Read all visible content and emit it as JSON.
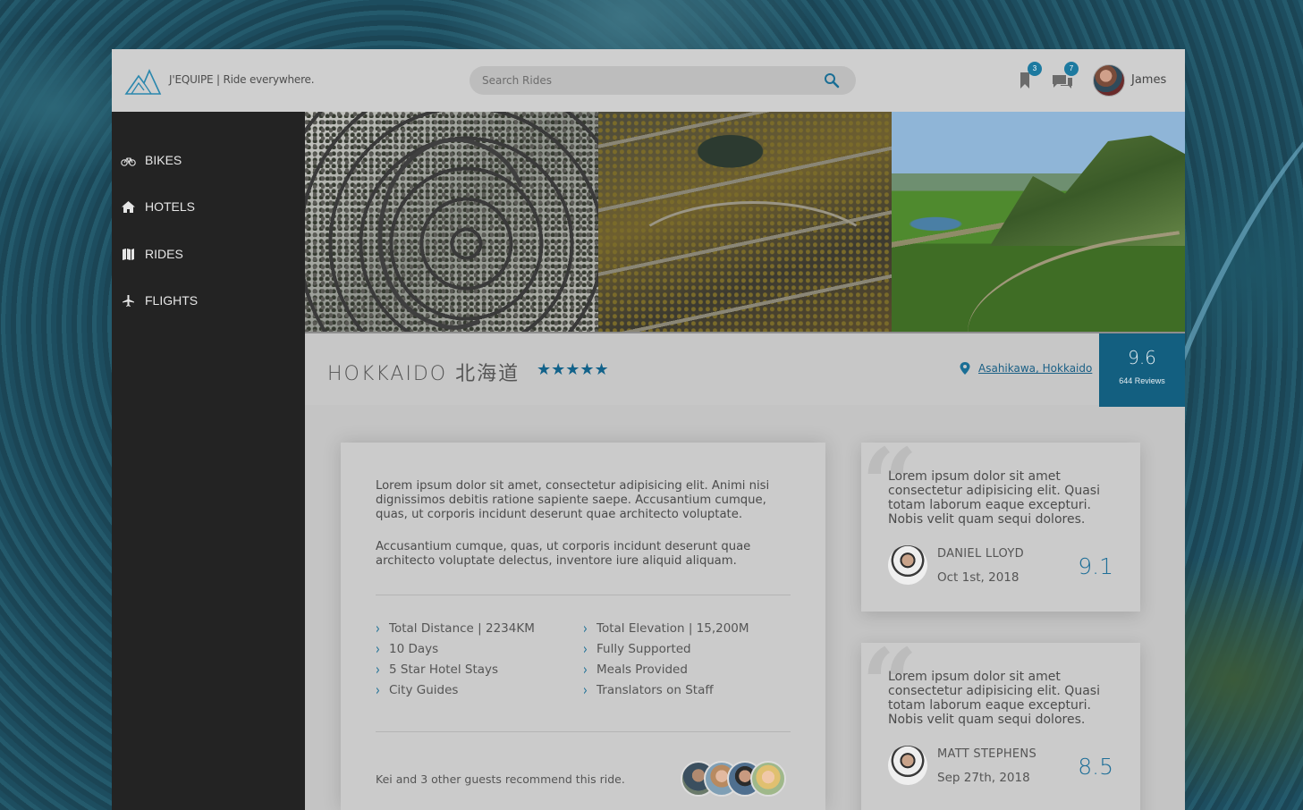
{
  "header": {
    "brand": "J'EQUIPE | Ride everywhere.",
    "search_placeholder": "Search Rides",
    "bookmarks_count": "3",
    "messages_count": "7",
    "user_name": "James"
  },
  "sidebar": {
    "items": [
      {
        "label": "BIKES",
        "icon": "bike-icon"
      },
      {
        "label": "HOTELS",
        "icon": "home-icon"
      },
      {
        "label": "RIDES",
        "icon": "map-icon"
      },
      {
        "label": "FLIGHTS",
        "icon": "plane-icon"
      }
    ]
  },
  "ride": {
    "title": "HOKKAIDO 北海道",
    "stars": "★★★★★",
    "rating": 5,
    "location": "Asahikawa, Hokkaido",
    "score": "9.6",
    "reviews": "644 Reviews"
  },
  "description": {
    "paragraphs": [
      "Lorem ipsum dolor sit amet, consectetur adipisicing elit. Animi nisi dignissimos debitis ratione sapiente saepe. Accusantium cumque, quas, ut corporis incidunt deserunt quae architecto voluptate.",
      "Accusantium cumque, quas, ut corporis incidunt deserunt quae architecto voluptate delectus, inventore iure aliquid aliquam."
    ],
    "features_left": [
      "Total Distance | 2234KM",
      "10 Days",
      "5 Star Hotel Stays",
      "City Guides"
    ],
    "features_right": [
      "Total Elevation | 15,200M",
      "Fully Supported",
      "Meals Provided",
      "Translators on Staff"
    ],
    "recommend_text": "Kei and 3 other guests recommend this ride."
  },
  "reviews": [
    {
      "text": "Lorem ipsum dolor sit amet consectetur adipisicing elit. Quasi totam laborum eaque excepturi. Nobis velit quam sequi dolores.",
      "name": "DANIEL LLOYD",
      "date": "Oct 1st, 2018",
      "score": "9.1"
    },
    {
      "text": "Lorem ipsum dolor sit amet consectetur adipisicing elit. Quasi totam laborum eaque excepturi. Nobis velit quam sequi dolores.",
      "name": "MATT STEPHENS",
      "date": "Sep 27th, 2018",
      "score": "8.5"
    }
  ],
  "colors": {
    "accent": "#135f80",
    "sidebar": "#232323",
    "panel": "#c4c4c4"
  }
}
